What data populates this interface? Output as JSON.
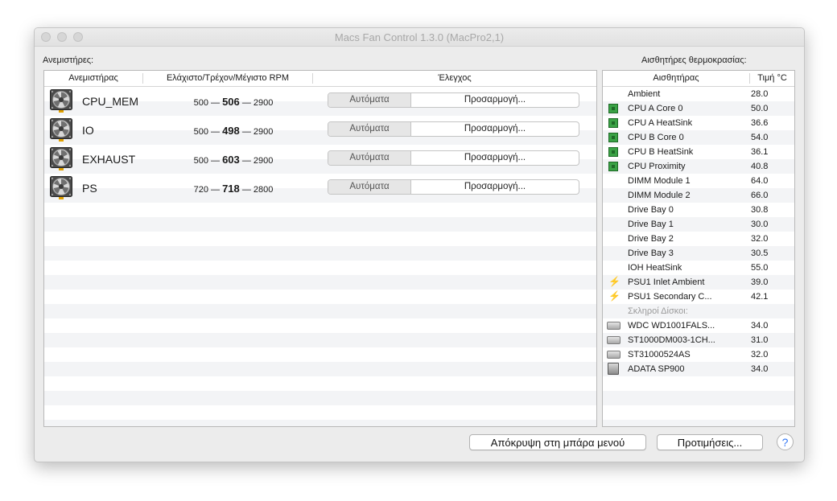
{
  "window": {
    "title": "Macs Fan Control 1.3.0 (MacPro2,1)"
  },
  "fans_section": {
    "label": "Ανεμιστήρες:",
    "columns": {
      "fan": "Ανεμιστήρας",
      "rpm": "Ελάχιστο/Τρέχον/Μέγιστο RPM",
      "control": "Έλεγχος"
    },
    "fans": [
      {
        "name": "CPU_MEM",
        "min": "500",
        "current": "506",
        "max": "2900",
        "auto_label": "Αυτόματα",
        "custom_label": "Προσαρμογή..."
      },
      {
        "name": "IO",
        "min": "500",
        "current": "498",
        "max": "2900",
        "auto_label": "Αυτόματα",
        "custom_label": "Προσαρμογή..."
      },
      {
        "name": "EXHAUST",
        "min": "500",
        "current": "603",
        "max": "2900",
        "auto_label": "Αυτόματα",
        "custom_label": "Προσαρμογή..."
      },
      {
        "name": "PS",
        "min": "720",
        "current": "718",
        "max": "2800",
        "auto_label": "Αυτόματα",
        "custom_label": "Προσαρμογή..."
      }
    ],
    "separator": "—"
  },
  "sensors_section": {
    "label": "Αισθητήρες θερμοκρασίας:",
    "columns": {
      "sensor": "Αισθητήρας",
      "value": "Τιμή °C"
    },
    "sensors": [
      {
        "name": "Ambient",
        "value": "28.0",
        "icon": "none"
      },
      {
        "name": "CPU A Core 0",
        "value": "50.0",
        "icon": "cpu-chip-icon"
      },
      {
        "name": "CPU A HeatSink",
        "value": "36.6",
        "icon": "cpu-chip-icon"
      },
      {
        "name": "CPU B Core 0",
        "value": "54.0",
        "icon": "cpu-chip-icon"
      },
      {
        "name": "CPU B HeatSink",
        "value": "36.1",
        "icon": "cpu-chip-icon"
      },
      {
        "name": "CPU Proximity",
        "value": "40.8",
        "icon": "cpu-chip-icon"
      },
      {
        "name": "DIMM Module 1",
        "value": "64.0",
        "icon": "none"
      },
      {
        "name": "DIMM Module 2",
        "value": "66.0",
        "icon": "none"
      },
      {
        "name": "Drive Bay 0",
        "value": "30.8",
        "icon": "none"
      },
      {
        "name": "Drive Bay 1",
        "value": "30.0",
        "icon": "none"
      },
      {
        "name": "Drive Bay 2",
        "value": "32.0",
        "icon": "none"
      },
      {
        "name": "Drive Bay 3",
        "value": "30.5",
        "icon": "none"
      },
      {
        "name": "IOH HeatSink",
        "value": "55.0",
        "icon": "none"
      },
      {
        "name": "PSU1 Inlet Ambient",
        "value": "39.0",
        "icon": "lightning-bolt-icon"
      },
      {
        "name": "PSU1 Secondary C...",
        "value": "42.1",
        "icon": "lightning-bolt-icon"
      }
    ],
    "disks_group_label": "Σκληροί Δίσκοι:",
    "disks": [
      {
        "name": "WDC WD1001FALS...",
        "value": "34.0",
        "icon": "hard-disk-icon"
      },
      {
        "name": "ST1000DM003-1CH...",
        "value": "31.0",
        "icon": "hard-disk-icon"
      },
      {
        "name": "ST31000524AS",
        "value": "32.0",
        "icon": "hard-disk-icon"
      },
      {
        "name": "ADATA SP900",
        "value": "34.0",
        "icon": "ssd-icon"
      }
    ]
  },
  "footer": {
    "hide_button": "Απόκρυψη στη μπάρα μενού",
    "preferences_button": "Προτιμήσεις...",
    "help_button": "?"
  }
}
